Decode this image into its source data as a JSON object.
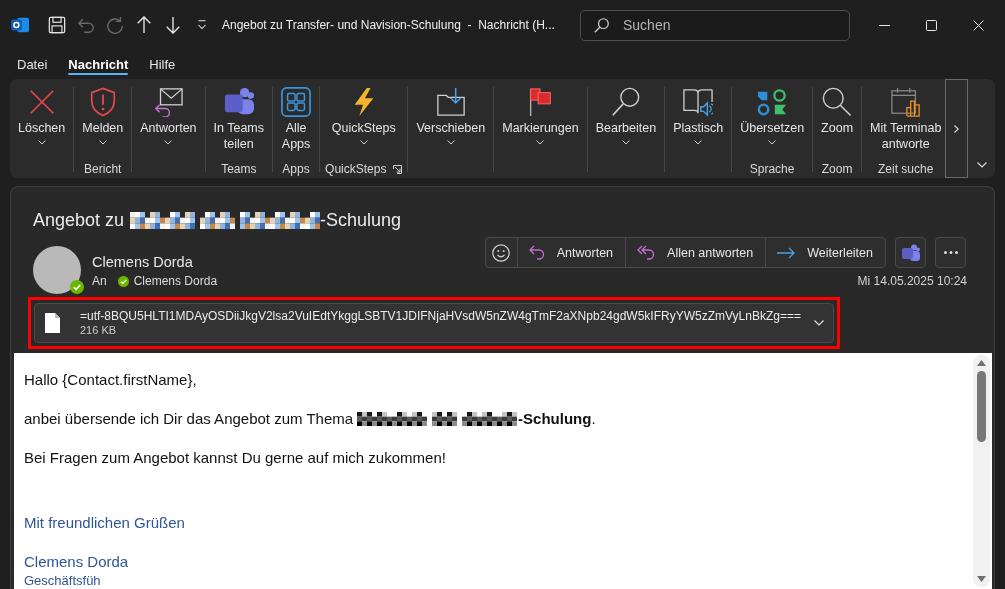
{
  "window": {
    "title": "Angebot zu Transfer- und Navision-Schulung  -  Nachricht (H...",
    "quick_access": [
      {
        "kind": "save",
        "disabled": false
      },
      {
        "kind": "undo",
        "disabled": true
      },
      {
        "kind": "redo",
        "disabled": true
      },
      {
        "kind": "up",
        "disabled": false
      },
      {
        "kind": "down",
        "disabled": false
      },
      {
        "kind": "customize",
        "disabled": false
      }
    ],
    "search": {
      "placeholder": "Suchen"
    }
  },
  "menu_tabs": [
    {
      "label": "Datei",
      "selected": false
    },
    {
      "label": "Nachricht",
      "selected": true
    },
    {
      "label": "Hilfe",
      "selected": false
    }
  ],
  "ribbon": {
    "groups": [
      {
        "launcher": false,
        "commands": [
          {
            "kind": "delete",
            "lines": [
              "Löschen"
            ],
            "dropdown": true
          }
        ]
      },
      {
        "label": "Bericht",
        "launcher": false,
        "commands": [
          {
            "kind": "report",
            "lines": [
              "Melden"
            ],
            "dropdown": true
          }
        ]
      },
      {
        "launcher": false,
        "commands": [
          {
            "kind": "respond",
            "lines": [
              "Antworten"
            ],
            "dropdown": true
          }
        ]
      },
      {
        "label": "Teams",
        "launcher": false,
        "commands": [
          {
            "kind": "teams",
            "lines": [
              "In Teams",
              "teilen"
            ],
            "dropdown": false
          }
        ]
      },
      {
        "label": "Apps",
        "launcher": false,
        "commands": [
          {
            "kind": "apps",
            "lines": [
              "Alle",
              "Apps"
            ],
            "dropdown": false
          }
        ]
      },
      {
        "label": "QuickSteps",
        "launcher": true,
        "commands": [
          {
            "kind": "quicksteps",
            "lines": [
              "QuickSteps"
            ],
            "dropdown": true
          }
        ]
      },
      {
        "launcher": false,
        "commands": [
          {
            "kind": "move",
            "lines": [
              "Verschieben"
            ],
            "dropdown": true
          }
        ]
      },
      {
        "launcher": false,
        "commands": [
          {
            "kind": "flag",
            "lines": [
              "Markierungen"
            ],
            "dropdown": true
          }
        ]
      },
      {
        "launcher": false,
        "commands": [
          {
            "kind": "edit",
            "lines": [
              "Bearbeiten"
            ],
            "dropdown": true
          }
        ]
      },
      {
        "launcher": false,
        "commands": [
          {
            "kind": "reader",
            "lines": [
              "Plastisch"
            ],
            "dropdown": true
          }
        ]
      },
      {
        "label": "Sprache",
        "launcher": false,
        "commands": [
          {
            "kind": "translate",
            "lines": [
              "Übersetzen"
            ],
            "dropdown": true
          }
        ]
      },
      {
        "label": "Zoom",
        "launcher": false,
        "commands": [
          {
            "kind": "zoom",
            "lines": [
              "Zoom"
            ],
            "dropdown": false
          }
        ]
      },
      {
        "label": "Zeit suche",
        "launcher": false,
        "commands": [
          {
            "kind": "schedule",
            "lines": [
              "Mit Terminab",
              "antworte"
            ],
            "dropdown": false
          }
        ]
      }
    ]
  },
  "message": {
    "subject": {
      "before": "Angebot zu",
      "redacted": true,
      "after": "-Schulung"
    },
    "sender": {
      "name": "Clemens Dorda",
      "available": true
    },
    "to_label": "An",
    "recipients": [
      {
        "name": "Clemens Dorda",
        "available": true
      }
    ],
    "actions": [
      {
        "kind": "react"
      },
      {
        "kind": "reply",
        "label": "Antworten"
      },
      {
        "kind": "reply_all",
        "label": "Allen antworten"
      },
      {
        "kind": "forward",
        "label": "Weiterleiten"
      }
    ],
    "extra_actions": [
      {
        "kind": "teams"
      },
      {
        "kind": "more"
      }
    ],
    "date": "Mi 14.05.2025 10:24",
    "attachment": {
      "name": "=utf-8BQU5HLTI1MDAyOSDiiJkgV2lsa2VuIEdtYkggLSBTV1JDIFNjaHVsdW5nZW4gTmF2aXNpb24gdW5kIFRyYW5zZmVyLnBkZg===",
      "size": "216 KB",
      "highlighted": true
    },
    "body": [
      {
        "kind": "text",
        "text": "Hallo {Contact.firstName},"
      },
      {
        "kind": "redacted_text",
        "before": "anbei übersende ich Dir das Angebot zum Thema",
        "redacted": true,
        "after": "**-Schulung**."
      },
      {
        "kind": "text",
        "text": "Bei Fragen zum Angebot kannst Du gerne auf mich zukommen!"
      }
    ],
    "signature": {
      "closing": "Mit freundlichen Grüßen",
      "name": "Clemens Dorda",
      "title": "Geschäftsfüh"
    }
  }
}
